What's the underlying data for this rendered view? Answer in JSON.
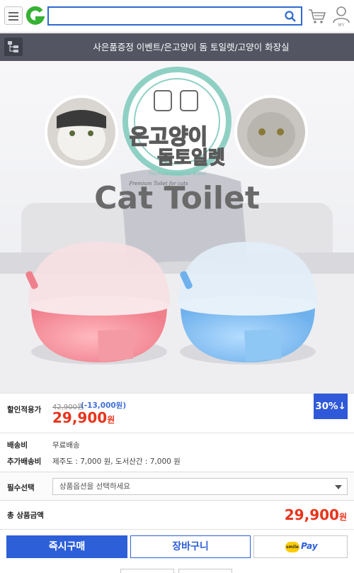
{
  "header": {
    "logo_letter": "G",
    "search_value": "",
    "my_label": "MY"
  },
  "breadcrumb": {
    "text": "사은품증정 이벤트/은고양이 돔 토일렛/고양이 화장실"
  },
  "product_image": {
    "brand_korean_line1": "은고양이",
    "brand_korean_line2": "돔토일렛",
    "badge_tagline": "The Professional Pet Brand",
    "sub_tagline": "Premium Toilet for cats",
    "headline": "Cat Toilet"
  },
  "price": {
    "label": "할인적용가",
    "original": "42,900원",
    "discount": "(-13,000원)",
    "sale_value": "29,900",
    "sale_unit": "원",
    "rate_badge": "30%↓"
  },
  "shipping": {
    "fee_label": "배송비",
    "fee_value": "무료배송",
    "extra_label": "추가배송비",
    "extra_value": "제주도 : 7,000 원, 도서산간 : 7,000 원"
  },
  "option": {
    "label": "필수선택",
    "placeholder": "상품옵션을 선택하세요"
  },
  "total": {
    "label": "총 상품금액",
    "value": "29,900",
    "unit": "원"
  },
  "actions": {
    "buy_now": "즉시구매",
    "add_cart": "장바구니",
    "smile_logo": "smile",
    "smile_pay": "Pay"
  },
  "colors": {
    "accent_blue": "#2d5fd8",
    "price_red": "#e8341c",
    "crumb_bg": "#535563",
    "logo_green": "#35b233"
  }
}
